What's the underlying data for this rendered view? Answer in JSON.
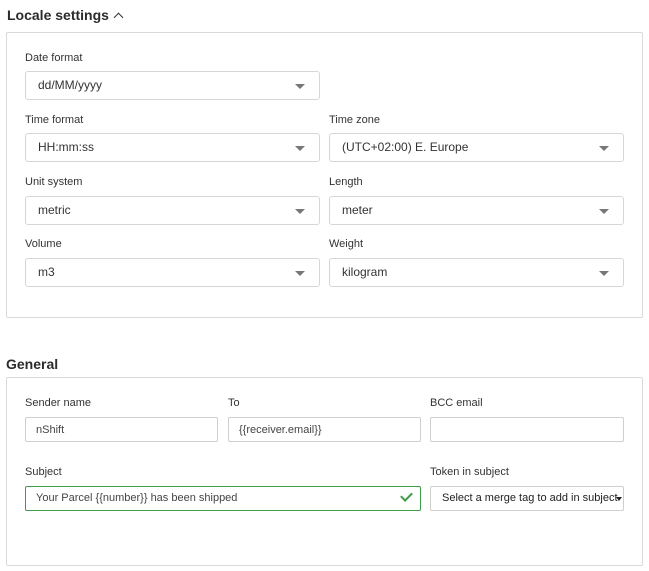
{
  "locale": {
    "title": "Locale settings",
    "date_format": {
      "label": "Date format",
      "value": "dd/MM/yyyy"
    },
    "time_format": {
      "label": "Time format",
      "value": "HH:mm:ss"
    },
    "time_zone": {
      "label": "Time zone",
      "value": "(UTC+02:00) E. Europe"
    },
    "unit_system": {
      "label": "Unit system",
      "value": "metric"
    },
    "length": {
      "label": "Length",
      "value": "meter"
    },
    "volume": {
      "label": "Volume",
      "value": "m3"
    },
    "weight": {
      "label": "Weight",
      "value": "kilogram"
    }
  },
  "general": {
    "title": "General",
    "sender_name": {
      "label": "Sender name",
      "value": "nShift"
    },
    "to": {
      "label": "To",
      "value": "{{receiver.email}}"
    },
    "bcc_email": {
      "label": "BCC email",
      "value": ""
    },
    "subject": {
      "label": "Subject",
      "value": "Your Parcel {{number}} has been shipped"
    },
    "token_in_subject": {
      "label": "Token in subject",
      "value": "Select a merge tag to add in subject"
    }
  },
  "colors": {
    "valid": "#3f9b49",
    "border": "#d9d9d9"
  }
}
